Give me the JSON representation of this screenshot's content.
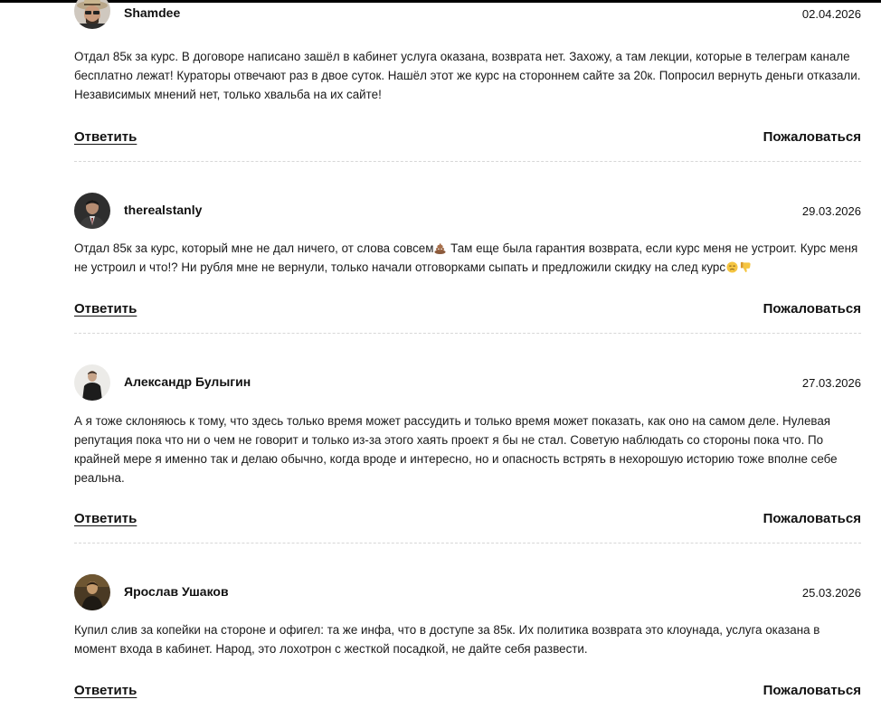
{
  "comments": [
    {
      "author": "Shamdee",
      "date": "02.04.2026",
      "text": "Отдал 85к за курс. В договоре написано зашёл в кабинет услуга оказана, возврата нет. Захожу, а там лекции, которые в телеграм каналe бесплатно лежат! Кураторы отвечают раз в двое суток. Нашёл этот же курс на стороннем сайте за 20к. Попросил вернуть деньги отказали. Независимых мнений нет, только хвальба на их сайте!",
      "reply_label": "Ответить",
      "report_label": "Пожаловаться",
      "avatar_icon": "avatar-man-hat-glasses"
    },
    {
      "author": "therealstanly",
      "date": "29.03.2026",
      "text_part1": "Отдал 85к за курс, который мне не дал ничего, от слова совсем",
      "text_part2": " Там еще была гарантия возврата, если курс меня не устроит. Курс меня не устроил и что!? Ни рубля мне не вернули, только начали отговорками сыпать и предложили скидку на след курс",
      "emoji1": "pile-of-poo-emoji",
      "emoji2": "unamused-face-emoji",
      "emoji3": "thumbs-down-emoji",
      "reply_label": "Ответить",
      "report_label": "Пожаловаться",
      "avatar_icon": "avatar-man-suit"
    },
    {
      "author": "Александр Булыгин",
      "date": "27.03.2026",
      "text": "А я тоже склоняюсь к тому, что здесь только время может рассудить и только время может показать, как оно на самом деле. Нулевая репутация пока что ни о чем не говорит и только из-за этого хаять проект я бы не стал. Советую наблюдать со стороны пока что. По крайней мере я именно так и делаю обычно, когда вроде и интересно, но и опасность встрять в нехорошую историю тоже вполне себе реальна.",
      "reply_label": "Ответить",
      "report_label": "Пожаловаться",
      "avatar_icon": "avatar-man-standing"
    },
    {
      "author": "Ярослав Ушаков",
      "date": "25.03.2026",
      "text": "Купил слив за копейки на стороне и офигел: та же инфа, что в доступе за 85к. Их политика возврата это клоунада, услуга оказана в момент входа в кабинет. Народ, это лохотрон с жесткой посадкой, не дайте себя развести.",
      "reply_label": "Ответить",
      "report_label": "Пожаловаться",
      "avatar_icon": "avatar-man-dark"
    }
  ]
}
